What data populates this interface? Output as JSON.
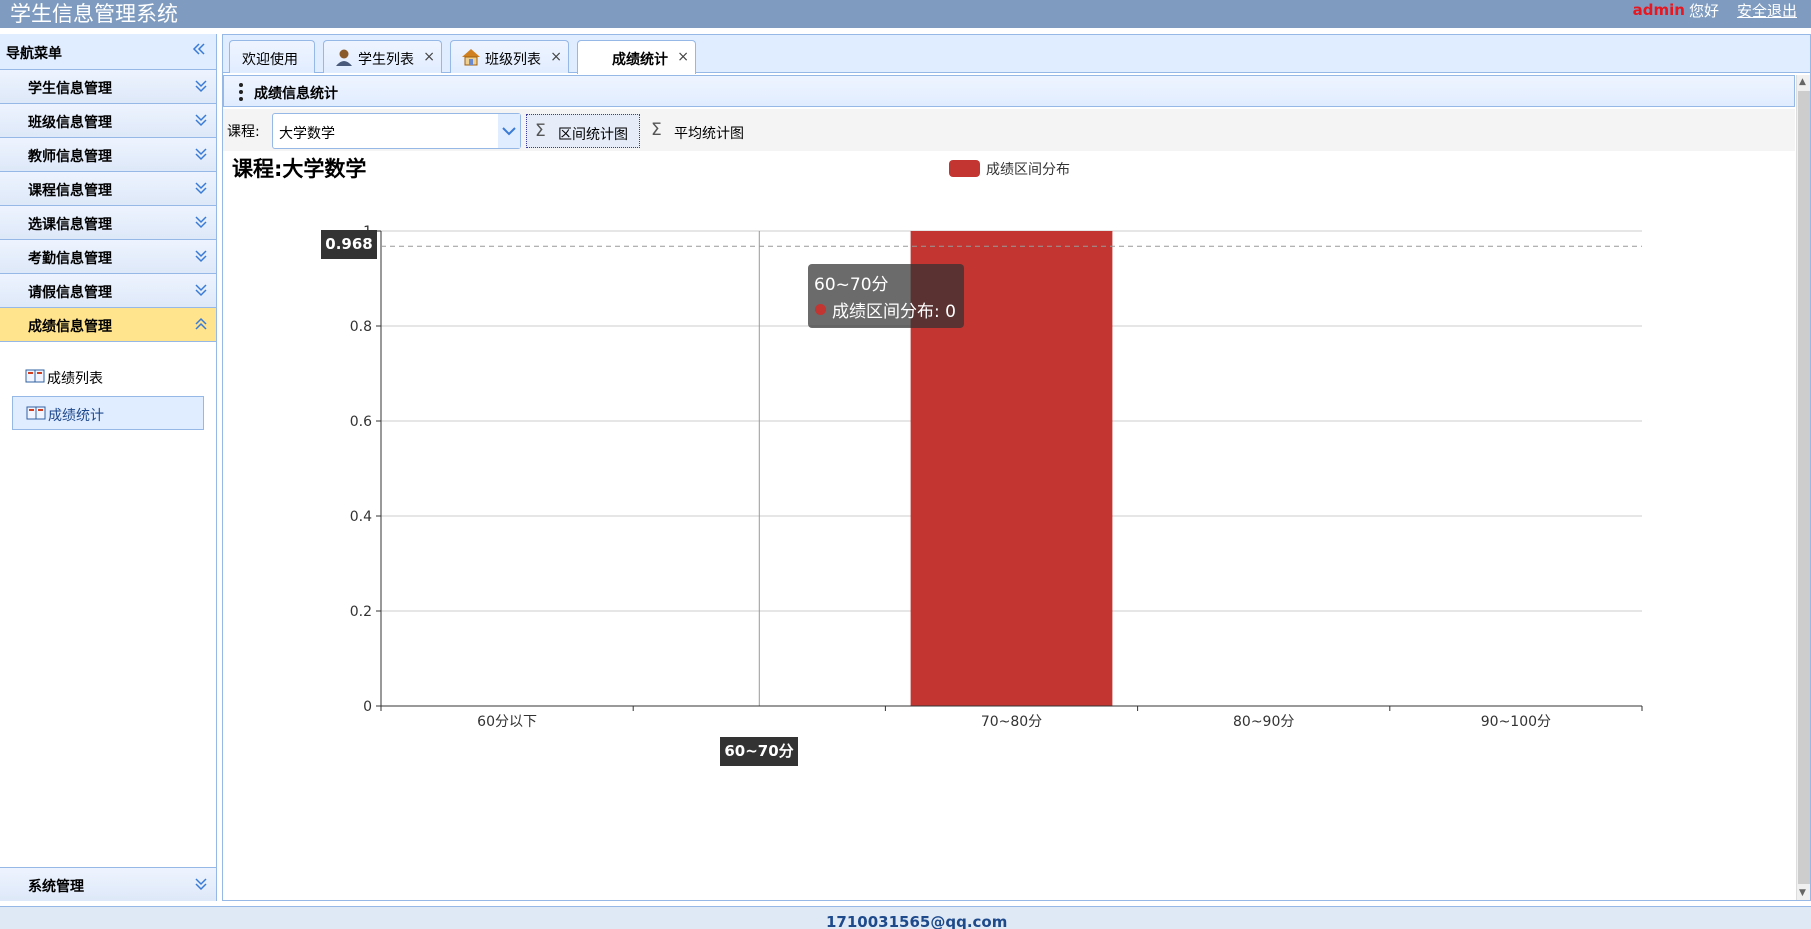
{
  "header": {
    "app_title": "学生信息管理系统",
    "user_name": "admin",
    "greeting": "您好",
    "logout_label": "安全退出"
  },
  "sidebar": {
    "title": "导航菜单",
    "items": [
      {
        "label": "学生信息管理"
      },
      {
        "label": "班级信息管理"
      },
      {
        "label": "教师信息管理"
      },
      {
        "label": "课程信息管理"
      },
      {
        "label": "选课信息管理"
      },
      {
        "label": "考勤信息管理"
      },
      {
        "label": "请假信息管理"
      },
      {
        "label": "成绩信息管理"
      }
    ],
    "subitems": [
      {
        "label": "成绩列表"
      },
      {
        "label": "成绩统计"
      }
    ],
    "bottom_item": {
      "label": "系统管理"
    }
  },
  "tabs": [
    {
      "label": "欢迎使用"
    },
    {
      "label": "学生列表"
    },
    {
      "label": "班级列表"
    },
    {
      "label": "成绩统计"
    }
  ],
  "panel": {
    "title": "成绩信息统计"
  },
  "toolbar": {
    "course_label": "课程:",
    "course_value": "大学数学",
    "btn_interval": "区间统计图",
    "btn_average": "平均统计图",
    "btn_icon": "Σ"
  },
  "chart_data": {
    "type": "bar",
    "title": "课程:大学数学",
    "categories": [
      "60分以下",
      "60~70分",
      "70~80分",
      "80~90分",
      "90~100分"
    ],
    "series": [
      {
        "name": "成绩区间分布",
        "values": [
          0,
          0,
          1,
          0,
          0
        ],
        "color": "#c23531"
      }
    ],
    "ylim": [
      0,
      1
    ],
    "yticks": [
      "0",
      "0.2",
      "0.4",
      "0.6",
      "0.8",
      "1"
    ],
    "grid": true,
    "legend_position": "top-center",
    "tooltip": {
      "title": "60~70分",
      "series": "成绩区间分布",
      "value": "0"
    },
    "axis_pointer": {
      "y_value": "0.968",
      "x_label": "60~70分"
    }
  },
  "footer": {
    "text": "1710031565@qq.com"
  }
}
